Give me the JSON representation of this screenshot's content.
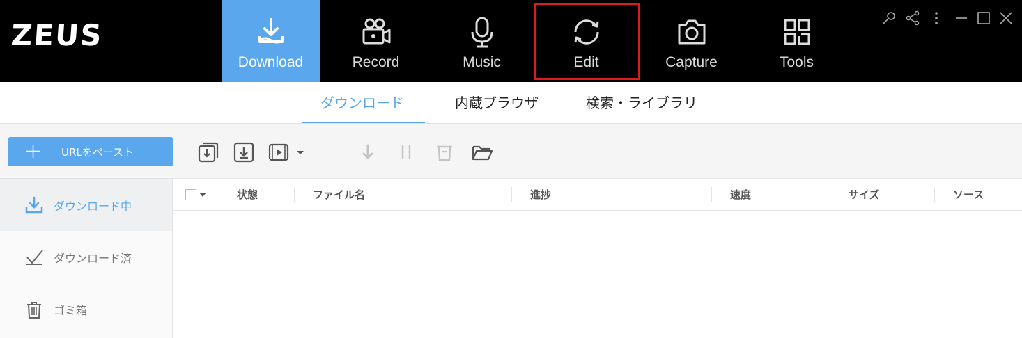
{
  "app": {
    "logo": "ZEUS"
  },
  "nav": {
    "tabs": [
      {
        "label": "Download",
        "icon": "download-icon",
        "active": true
      },
      {
        "label": "Record",
        "icon": "video-camera-icon"
      },
      {
        "label": "Music",
        "icon": "microphone-icon"
      },
      {
        "label": "Edit",
        "icon": "refresh-cycle-icon",
        "highlighted": true
      },
      {
        "label": "Capture",
        "icon": "camera-icon"
      },
      {
        "label": "Tools",
        "icon": "tools-grid-icon"
      }
    ]
  },
  "window_controls": [
    "pin-icon",
    "share-icon",
    "more-icon",
    "minimize-icon",
    "maximize-icon",
    "close-icon"
  ],
  "subtabs": {
    "items": [
      {
        "label": "ダウンロード",
        "active": true
      },
      {
        "label": "内蔵ブラウザ"
      },
      {
        "label": "検索・ライブラリ"
      }
    ]
  },
  "toolbar": {
    "paste_plus": "+",
    "paste_label": "URLをペースト",
    "tools": [
      "batch-download-icon",
      "download-box-icon",
      "video-convert-icon",
      "start-icon",
      "pause-icon",
      "delete-icon",
      "open-folder-icon"
    ]
  },
  "sidebar": {
    "items": [
      {
        "label": "ダウンロード中",
        "icon": "download-tray-icon",
        "active": true
      },
      {
        "label": "ダウンロード済",
        "icon": "checkmark-icon"
      },
      {
        "label": "ゴミ箱",
        "icon": "trash-icon"
      }
    ]
  },
  "table": {
    "headers": [
      "状態",
      "ファイル名",
      "進捗",
      "速度",
      "サイズ",
      "ソース"
    ],
    "rows": []
  },
  "colors": {
    "accent": "#5aa7ee",
    "highlight": "#e0191c",
    "header_bg": "#000000"
  }
}
